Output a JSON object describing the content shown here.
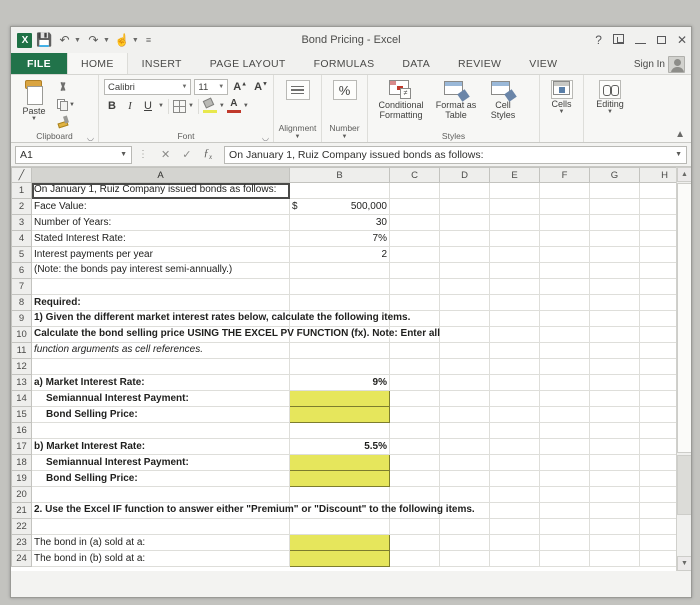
{
  "window": {
    "title": "Bond Pricing - Excel",
    "sign_in": "Sign In",
    "help_icon": "?",
    "ribbon_display_icon": "ribbon-display-options",
    "minimize_icon": "minimize",
    "restore_icon": "restore",
    "close_icon": "close"
  },
  "quick_access": {
    "logo": "X",
    "save_icon": "save",
    "undo_icon": "undo",
    "redo_icon": "redo",
    "touch_icon": "touch-mouse-mode",
    "more_icon": "customize-quick-access"
  },
  "tabs": [
    {
      "label": "FILE",
      "id": "file"
    },
    {
      "label": "HOME",
      "id": "home"
    },
    {
      "label": "INSERT",
      "id": "insert"
    },
    {
      "label": "PAGE LAYOUT",
      "id": "page-layout"
    },
    {
      "label": "FORMULAS",
      "id": "formulas"
    },
    {
      "label": "DATA",
      "id": "data"
    },
    {
      "label": "REVIEW",
      "id": "review"
    },
    {
      "label": "VIEW",
      "id": "view"
    }
  ],
  "ribbon": {
    "clipboard": {
      "group_label": "Clipboard",
      "paste_label": "Paste",
      "cut_label": "Cut",
      "copy_label": "Copy",
      "format_painter_label": "Format Painter"
    },
    "font": {
      "group_label": "Font",
      "font_name": "Calibri",
      "font_size": "11",
      "grow_font": "A",
      "shrink_font": "A",
      "bold": "B",
      "italic": "I",
      "underline": "U",
      "font_color_letter": "A"
    },
    "alignment": {
      "group_label": "Alignment",
      "label": "Alignment"
    },
    "number": {
      "group_label": "Number",
      "label": "Number",
      "symbol": "%"
    },
    "styles": {
      "group_label": "Styles",
      "conditional_formatting": "Conditional Formatting",
      "format_as_table": "Format as Table",
      "cell_styles": "Cell Styles"
    },
    "cells": {
      "label": "Cells"
    },
    "editing": {
      "label": "Editing"
    },
    "collapse_icon": "collapse-ribbon"
  },
  "formula_bar": {
    "name_box": "A1",
    "cancel_icon": "cancel",
    "enter_icon": "enter",
    "function_icon": "fx",
    "content": "On January 1,  Ruiz Company issued bonds as follows:",
    "expand_icon": "expand-formula-bar"
  },
  "grid": {
    "columns": [
      "A",
      "B",
      "C",
      "D",
      "E",
      "F",
      "G",
      "H"
    ],
    "selected_column": "A",
    "selected_cell": "A1",
    "rows": [
      {
        "n": "1",
        "a": "On January 1,  Ruiz Company issued bonds as follows:",
        "b": "",
        "style": "overflow active"
      },
      {
        "n": "2",
        "a": "Face Value:",
        "b": "500,000",
        "b_prefix": "$",
        "style": "num"
      },
      {
        "n": "3",
        "a": "Number of Years:",
        "b": "30",
        "style": "num"
      },
      {
        "n": "4",
        "a": "Stated Interest Rate:",
        "b": "7%",
        "style": "num"
      },
      {
        "n": "5",
        "a": "Interest payments per year",
        "b": "2",
        "style": "num"
      },
      {
        "n": "6",
        "a": "(Note: the bonds pay interest semi-annually.)",
        "b": "",
        "style": "overflow"
      },
      {
        "n": "7",
        "a": "",
        "b": "",
        "style": ""
      },
      {
        "n": "8",
        "a": "Required:",
        "b": "",
        "style": "bold"
      },
      {
        "n": "9",
        "a": "1) Given the different market interest rates below, calculate the following items.",
        "b": "",
        "style": "bold overflow indent1"
      },
      {
        "n": "10",
        "a": "Calculate the bond selling price USING THE EXCEL PV FUNCTION (fx). Note: Enter all",
        "b": "",
        "style": "bold overflow"
      },
      {
        "n": "11",
        "a": "function arguments as cell references.",
        "b": "",
        "style": "italic overflow"
      },
      {
        "n": "12",
        "a": "",
        "b": "",
        "style": ""
      },
      {
        "n": "13",
        "a": "a)  Market Interest Rate:",
        "b": "9%",
        "style": "bold num"
      },
      {
        "n": "14",
        "a": "Semiannual Interest Payment:",
        "b": "",
        "style": "bold indent2 yellow"
      },
      {
        "n": "15",
        "a": "Bond Selling Price:",
        "b": "",
        "style": "bold indent2 yellow"
      },
      {
        "n": "16",
        "a": "",
        "b": "",
        "style": ""
      },
      {
        "n": "17",
        "a": "b)  Market Interest Rate:",
        "b": "5.5%",
        "style": "bold num"
      },
      {
        "n": "18",
        "a": "Semiannual Interest Payment:",
        "b": "",
        "style": "bold indent2 yellow"
      },
      {
        "n": "19",
        "a": "Bond Selling Price:",
        "b": "",
        "style": "bold indent2 yellow"
      },
      {
        "n": "20",
        "a": "",
        "b": "",
        "style": ""
      },
      {
        "n": "21",
        "a": "2. Use the Excel IF function to answer either \"Premium\" or \"Discount\" to the following items.",
        "b": "",
        "style": "bold overflow"
      },
      {
        "n": "22",
        "a": "",
        "b": "",
        "style": ""
      },
      {
        "n": "23",
        "a": "The bond in (a) sold at a:",
        "b": "",
        "style": "yellow"
      },
      {
        "n": "24",
        "a": "The bond in (b) sold at a:",
        "b": "",
        "style": "yellow"
      }
    ]
  },
  "colors": {
    "excel_green": "#21734a",
    "highlight_yellow": "#e6e65c",
    "highlight_border": "#7d7d2e"
  }
}
